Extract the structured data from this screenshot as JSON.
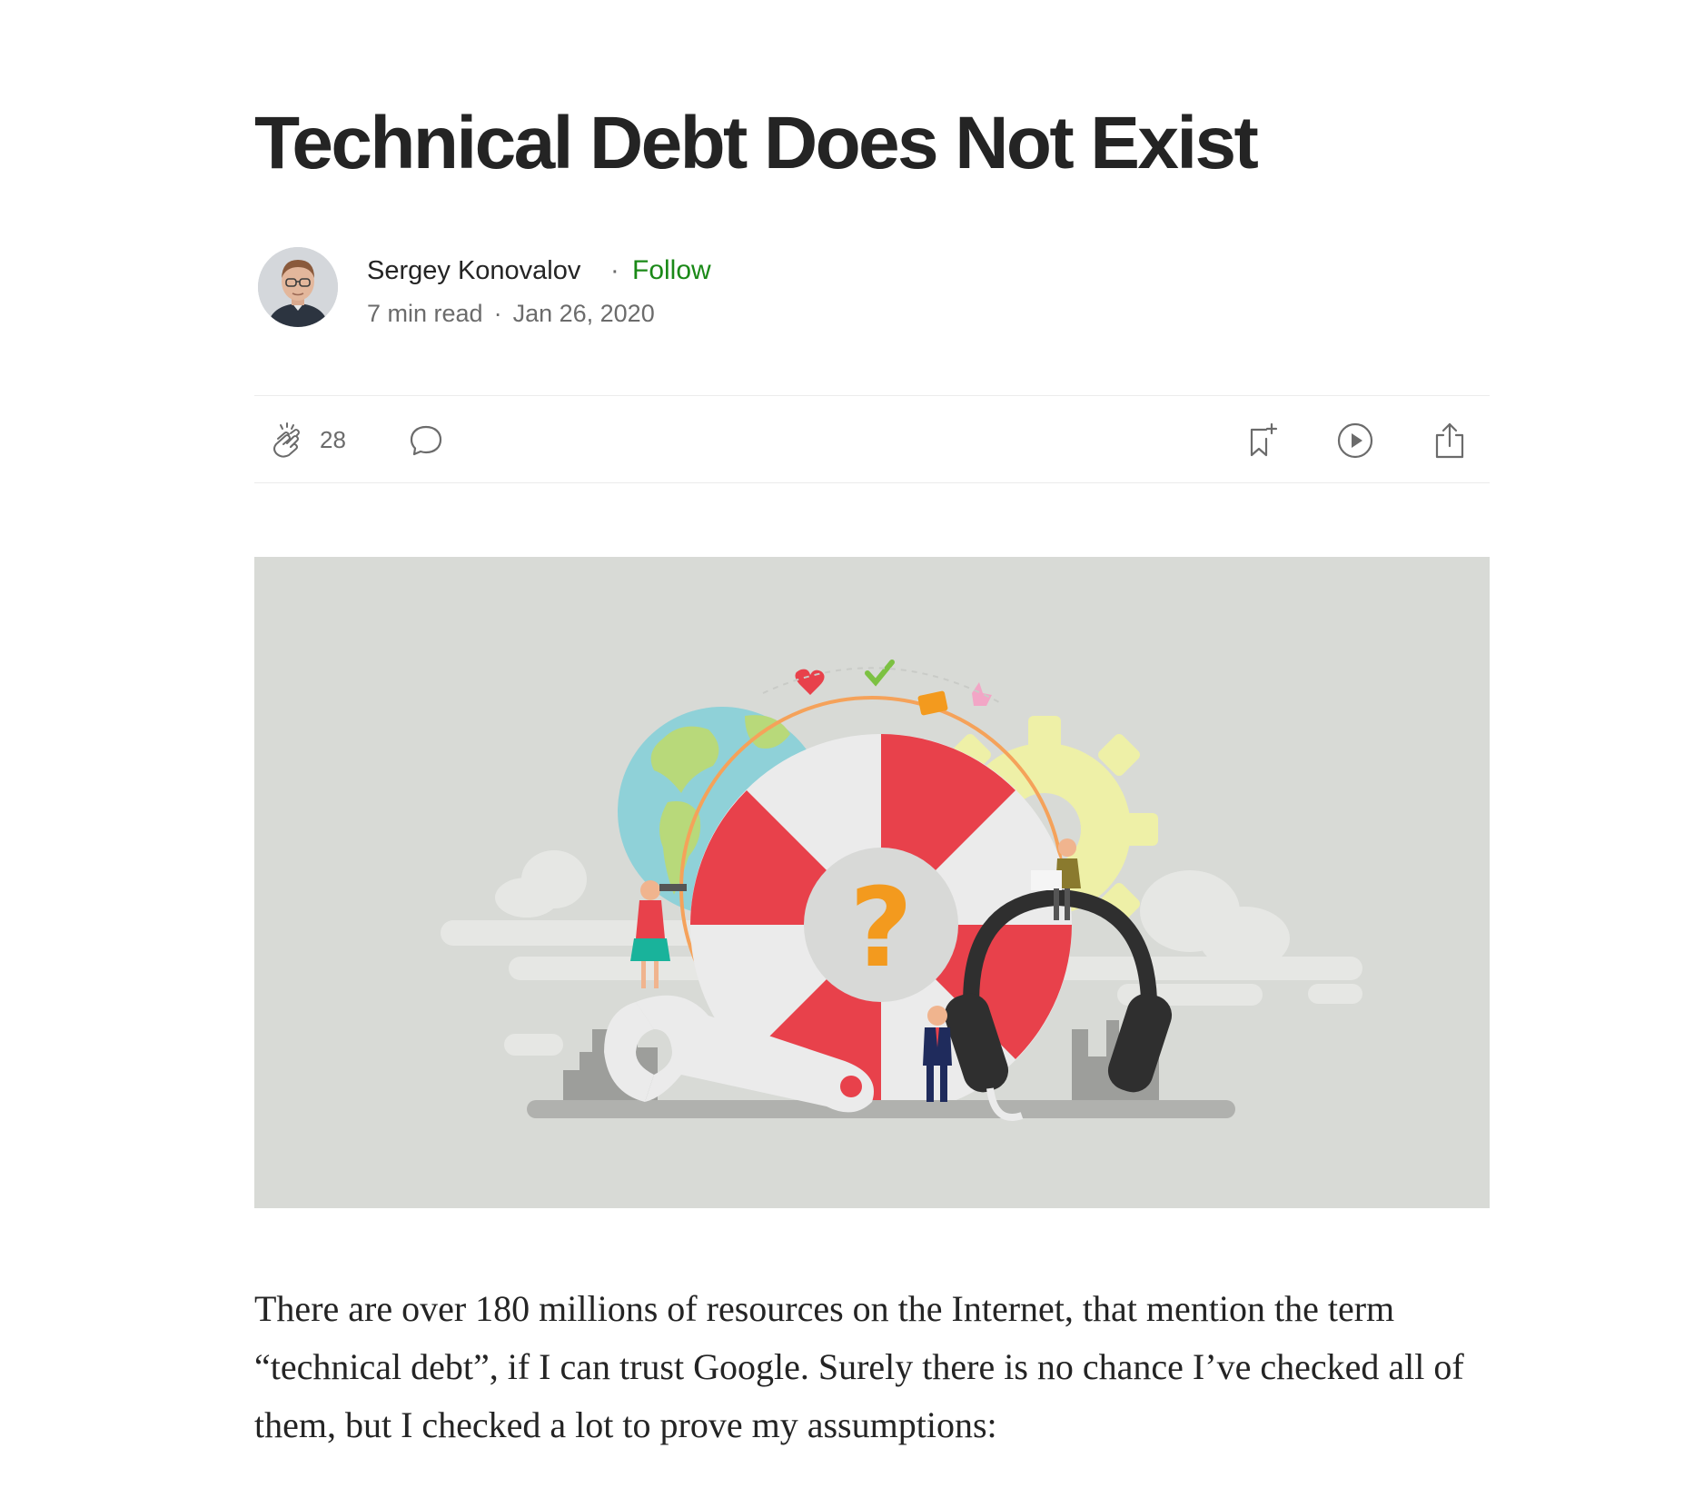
{
  "article": {
    "title": "Technical Debt Does Not Exist",
    "author": {
      "name": "Sergey Konovalov",
      "dot": "·",
      "follow_label": "Follow",
      "read_time": "7 min read",
      "meta_sep": "·",
      "date": "Jan 26, 2020"
    },
    "actions": {
      "clap_count": "28",
      "icons": [
        "clap-icon",
        "comment-icon",
        "bookmark-add-icon",
        "play-icon",
        "share-icon"
      ]
    },
    "body": {
      "paragraph_1": "There are over 180 millions of resources on the Internet, that mention the term “technical debt”, if I can trust Google. Surely there is no chance I’ve checked all of them, but I checked a lot to prove my assumptions:"
    }
  },
  "colors": {
    "text": "#242424",
    "muted": "#6b6b6b",
    "follow": "#1a8917",
    "hero_bg": "#d8dad6",
    "accent_red": "#e8414b",
    "accent_orange": "#f39a1e"
  }
}
